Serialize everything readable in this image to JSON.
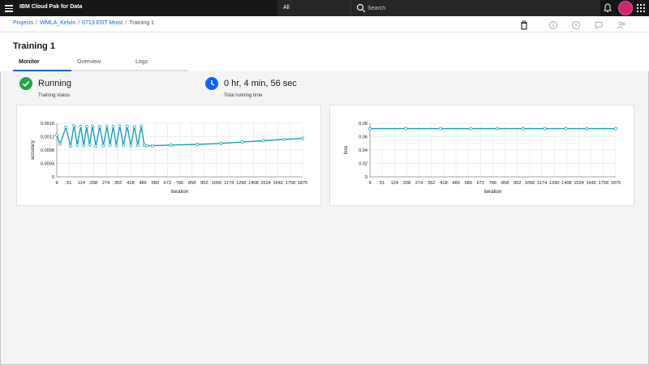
{
  "app": {
    "brand": "IBM Cloud Pak for Data",
    "scope_value": "All",
    "search_placeholder": "Search"
  },
  "breadcrumb": {
    "items": [
      "Projects",
      "WMLA_Kelvin",
      "0713 EDT Mnist"
    ],
    "current": "Training 1",
    "separator": "/"
  },
  "page": {
    "title": "Training 1",
    "tabs": [
      {
        "label": "Monitor",
        "active": true
      },
      {
        "label": "Overview",
        "active": false
      },
      {
        "label": "Logs",
        "active": false
      }
    ]
  },
  "status": {
    "state": "Running",
    "state_label": "Training status",
    "state_color": "#24a148",
    "elapsed": "0 hr, 4 min, 56 sec",
    "elapsed_label": "Total running time",
    "elapsed_color": "#0f62fe"
  },
  "icons": {
    "topbar": [
      "menu-icon",
      "search-icon",
      "notification-icon",
      "avatar",
      "app-switcher-icon"
    ],
    "header": [
      "delete-icon",
      "info-icon",
      "history-icon",
      "comment-icon",
      "collaborators-icon"
    ],
    "status": [
      "checkmark-icon",
      "clock-icon"
    ]
  },
  "colors": {
    "series": "#12a4b0",
    "tab_active": "#0f62fe",
    "link": "#0f62fe"
  },
  "chart_data": [
    {
      "type": "line",
      "title": "",
      "xlabel": "iteration",
      "ylabel": "accuracy",
      "x_ticks": [
        9,
        51,
        124,
        208,
        274,
        352,
        418,
        489,
        580,
        672,
        766,
        858,
        952,
        1056,
        1174,
        1290,
        1408,
        1524,
        1642,
        1758,
        1875
      ],
      "y_ticks": [
        "0",
        "0.0004",
        "0.0008",
        "0.0012",
        "0.0016"
      ],
      "ylim": [
        0,
        0.0016
      ],
      "grid": true,
      "series": [
        {
          "x": [
            9,
            20,
            40,
            60,
            80,
            100,
            120,
            140,
            160,
            180,
            200,
            220,
            240,
            260,
            280,
            300,
            320,
            340,
            360,
            380,
            400,
            420,
            440,
            460,
            480,
            500,
            520,
            560,
            700,
            900,
            1100,
            1300,
            1500,
            1700,
            1875
          ],
          "y": [
            0.00125,
            0.00098,
            0.00148,
            0.00092,
            0.00153,
            0.00095,
            0.00151,
            0.00093,
            0.0015,
            0.00095,
            0.00152,
            0.00092,
            0.0015,
            0.00093,
            0.00151,
            0.00095,
            0.0015,
            0.00093,
            0.00152,
            0.00094,
            0.00151,
            0.00093,
            0.0015,
            0.00094,
            0.00152,
            0.00094,
            0.00093,
            0.00093,
            0.00095,
            0.00097,
            0.001,
            0.00104,
            0.00108,
            0.00112,
            0.00115
          ]
        }
      ]
    },
    {
      "type": "line",
      "title": "",
      "xlabel": "iteration",
      "ylabel": "loss",
      "x_ticks": [
        9,
        51,
        124,
        208,
        274,
        352,
        418,
        489,
        580,
        672,
        766,
        858,
        952,
        1056,
        1174,
        1290,
        1408,
        1524,
        1642,
        1758,
        1875
      ],
      "y_ticks": [
        "0",
        "0.02",
        "0.04",
        "0.06",
        "0.08"
      ],
      "ylim": [
        0,
        0.08
      ],
      "grid": true,
      "series": [
        {
          "x": [
            9,
            200,
            400,
            600,
            800,
            1000,
            1200,
            1400,
            1600,
            1875
          ],
          "y": [
            0.072,
            0.072,
            0.072,
            0.072,
            0.072,
            0.072,
            0.072,
            0.072,
            0.072,
            0.072
          ]
        }
      ]
    }
  ]
}
